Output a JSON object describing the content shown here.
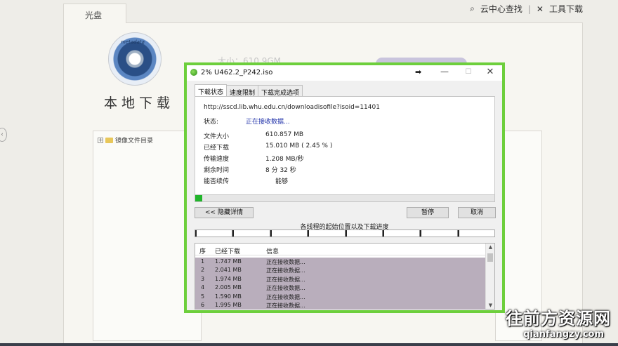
{
  "background": {
    "tab_label": "光盘",
    "top_links": {
      "search": "云中心查找",
      "tools": "工具下载"
    },
    "logo_text": "metadata",
    "local_download": "本地下载",
    "size_ghost": "大小：610.9GM",
    "tree_item": "镜像文件目录"
  },
  "dialog": {
    "title": "2% U462.2_P242.iso",
    "tabs": [
      "下载状态",
      "速度限制",
      "下载完成选项"
    ],
    "url": "http://sscd.lib.whu.edu.cn/downloadisofile?isoid=11401",
    "status_label": "状态:",
    "status_value": "正在接收数据...",
    "fields": [
      {
        "label": "文件大小",
        "value": "610.857  MB"
      },
      {
        "label": "已经下载",
        "value": "15.010  MB  ( 2.45 % )"
      },
      {
        "label": "传输速度",
        "value": "1.208  MB/秒"
      },
      {
        "label": "剩余时间",
        "value": "8 分 32 秒"
      },
      {
        "label": "能否续传",
        "value": "能够"
      }
    ],
    "progress_fraction": 0.0245,
    "buttons": {
      "hide": "<< 隐藏详情",
      "pause": "暂停",
      "cancel": "取消"
    },
    "segments_label": "各线程的起始位置以及下载进度",
    "list": {
      "headers": [
        "序",
        "已经下载",
        "信息"
      ],
      "rows": [
        {
          "n": "1",
          "size": "1.747  MB",
          "info": "正在接收数据..."
        },
        {
          "n": "2",
          "size": "2.041  MB",
          "info": "正在接收数据..."
        },
        {
          "n": "3",
          "size": "1.974  MB",
          "info": "正在接收数据..."
        },
        {
          "n": "4",
          "size": "2.005  MB",
          "info": "正在接收数据..."
        },
        {
          "n": "5",
          "size": "1.590  MB",
          "info": "正在接收数据..."
        },
        {
          "n": "6",
          "size": "1.995  MB",
          "info": "正在接收数据..."
        }
      ]
    }
  },
  "watermark": {
    "main": "往前方资源网",
    "sub": "qianfangzy.com"
  },
  "colors": {
    "dialog_border": "#6dcf3c",
    "progress_fill": "#21b52b",
    "status_blue": "#2233aa"
  }
}
